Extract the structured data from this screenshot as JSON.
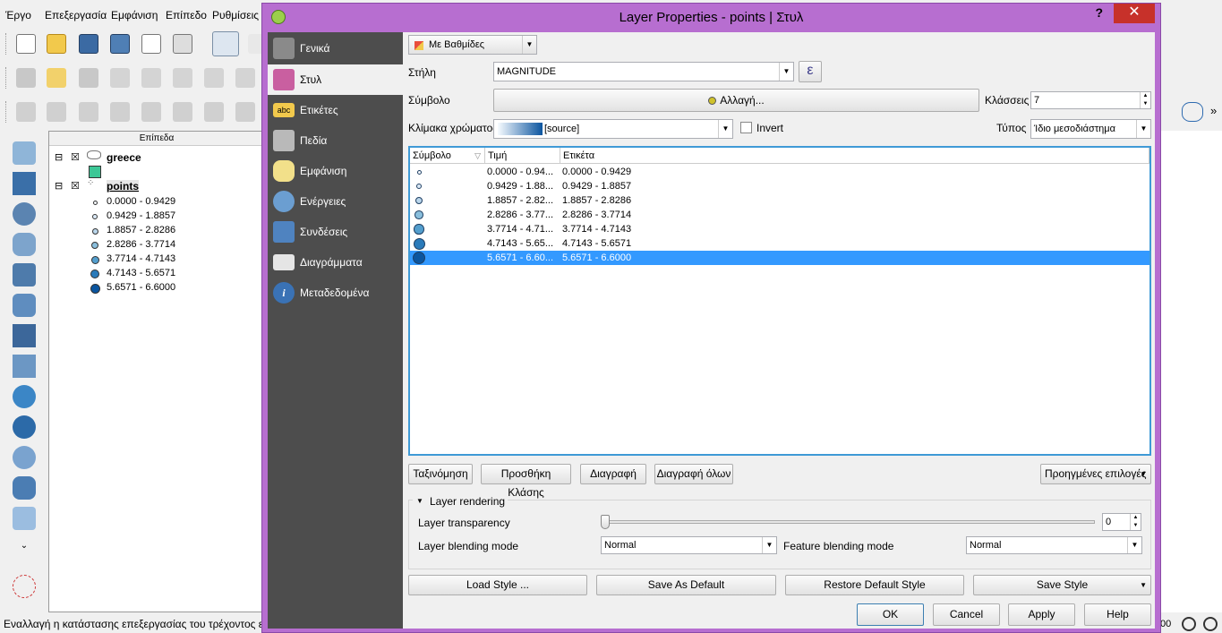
{
  "menu": [
    "Έργο",
    "Επεξεργασία",
    "Εμφάνιση",
    "Επίπεδο",
    "Ρυθμίσεις"
  ],
  "layers_panel": {
    "title": "Επίπεδα",
    "layers": [
      {
        "name": "greece",
        "color": "#3cc796"
      },
      {
        "name": "points",
        "classes": [
          "0.0000 - 0.9429",
          "0.9429 - 1.8857",
          "1.8857 - 2.8286",
          "2.8286 - 3.7714",
          "3.7714 - 4.7143",
          "4.7143 - 5.6571",
          "5.6571 - 6.6000"
        ]
      }
    ]
  },
  "statusbar": {
    "text": "Εναλλαγή η κατάστασης επεξεργασίας του τρέχοντος επιπεδ",
    "right_value": "00"
  },
  "dialog": {
    "title": "Layer Properties - points | Στυλ",
    "help": "?",
    "close": "✕",
    "sidebar": [
      "Γενικά",
      "Στυλ",
      "Ετικέτες",
      "Πεδία",
      "Εμφάνιση",
      "Ενέργειες",
      "Συνδέσεις",
      "Διαγράμματα",
      "Μεταδεδομένα"
    ],
    "renderer": "Με Βαθμίδες",
    "column_label": "Στήλη",
    "column_value": "MAGNITUDE",
    "expr_button": "ε",
    "symbol_label": "Σύμβολο",
    "symbol_button": "Αλλαγή...",
    "classes_label": "Κλάσσεις",
    "classes_value": "7",
    "ramp_label": "Κλίμακα χρώματος",
    "ramp_value": "[source]",
    "invert_label": "Invert",
    "mode_label": "Τύπος",
    "mode_value": "Ίδιο μεσοδιάστημα",
    "table": {
      "headers": [
        "Σύμβολο",
        "Τιμή",
        "Ετικέτα"
      ],
      "rows": [
        {
          "value": "0.0000 - 0.94...",
          "label": "0.0000 - 0.9429",
          "color": "#f7fbff"
        },
        {
          "value": "0.9429 - 1.88...",
          "label": "0.9429 - 1.8857",
          "color": "#dbe9f6"
        },
        {
          "value": "1.8857 - 2.82...",
          "label": "1.8857 - 2.8286",
          "color": "#bad6eb"
        },
        {
          "value": "2.8286 - 3.77...",
          "label": "2.8286 - 3.7714",
          "color": "#89bedc"
        },
        {
          "value": "3.7714 - 4.71...",
          "label": "3.7714 - 4.7143",
          "color": "#539ecd"
        },
        {
          "value": "4.7143 - 5.65...",
          "label": "4.7143 - 5.6571",
          "color": "#2b7bba"
        },
        {
          "value": "5.6571 - 6.60...",
          "label": "5.6571 - 6.6000",
          "color": "#0b559f"
        }
      ]
    },
    "buttons": {
      "classify": "Ταξινόμηση",
      "add_class": "Προσθήκη Κλάσης",
      "delete": "Διαγραφή",
      "delete_all": "Διαγραφή όλων",
      "advanced": "Προηγμένες επιλογές"
    },
    "layer_rendering": {
      "title": "Layer rendering",
      "transparency_label": "Layer transparency",
      "transparency_value": "0",
      "blending_label": "Layer blending mode",
      "blending_value": "Normal",
      "feature_blending_label": "Feature blending mode",
      "feature_blending_value": "Normal"
    },
    "style_buttons": {
      "load": "Load Style ...",
      "save_default": "Save As Default",
      "restore": "Restore Default Style",
      "save": "Save Style"
    },
    "footer": {
      "ok": "OK",
      "cancel": "Cancel",
      "apply": "Apply",
      "help": "Help"
    }
  }
}
